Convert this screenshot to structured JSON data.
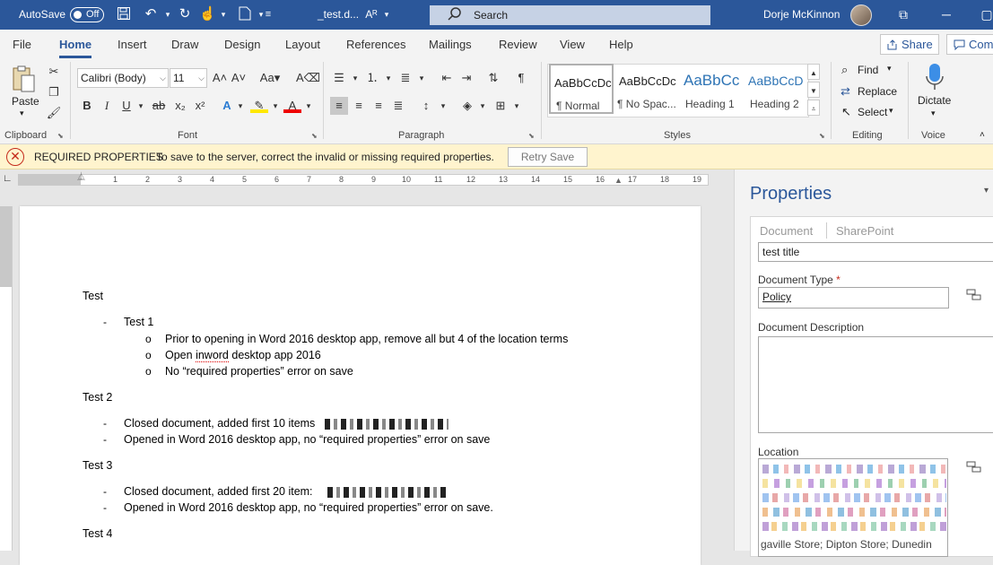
{
  "titlebar": {
    "autosave_label": "AutoSave",
    "autosave_state": "Off",
    "doc_name": "_test.d...",
    "search_placeholder": "Search",
    "user_name": "Dorje McKinnon"
  },
  "tabs": [
    "File",
    "Home",
    "Insert",
    "Draw",
    "Design",
    "Layout",
    "References",
    "Mailings",
    "Review",
    "View",
    "Help"
  ],
  "active_tab": "Home",
  "share_label": "Share",
  "comments_label": "Com",
  "ribbon": {
    "clipboard": {
      "paste_label": "Paste",
      "group_label": "Clipboard"
    },
    "font": {
      "font_name": "Calibri (Body)",
      "font_size": "11",
      "group_label": "Font",
      "case_label": "Aa"
    },
    "paragraph": {
      "group_label": "Paragraph"
    },
    "styles": {
      "group_label": "Styles",
      "items": [
        {
          "preview": "AaBbCcDc",
          "name": "¶ Normal"
        },
        {
          "preview": "AaBbCcDc",
          "name": "¶ No Spac..."
        },
        {
          "preview": "AaBbCc",
          "name": "Heading 1"
        },
        {
          "preview": "AaBbCcD",
          "name": "Heading 2"
        }
      ]
    },
    "editing": {
      "find": "Find",
      "replace": "Replace",
      "select": "Select",
      "group_label": "Editing"
    },
    "voice": {
      "dictate": "Dictate",
      "group_label": "Voice"
    }
  },
  "infobar": {
    "heading": "REQUIRED PROPERTIES",
    "message": "To save to the server, correct the invalid or missing required properties.",
    "retry_label": "Retry Save"
  },
  "ruler_numbers": [
    "1",
    "2",
    "3",
    "4",
    "5",
    "6",
    "7",
    "8",
    "9",
    "10",
    "11",
    "12",
    "13",
    "14",
    "15",
    "16",
    "17",
    "18",
    "19"
  ],
  "document": {
    "t1": "Test",
    "t1_b1": "Test 1",
    "t1_s1": "Prior to opening in Word 2016 desktop app, remove all but 4 of the location terms",
    "t1_s2_a": "Open ",
    "t1_s2_b": "inword",
    "t1_s2_c": " desktop app 2016",
    "t1_s3": "No “required properties” error on save",
    "t2": "Test 2",
    "t2_b1": "Closed document, added first 10 items",
    "t2_b2": "Opened in Word 2016 desktop app, no “required properties” error on save",
    "t3": "Test 3",
    "t3_b1": "Closed document, added first 20 item:",
    "t3_b2": "Opened in Word 2016 desktop app, no “required properties” error on save.",
    "t4": "Test 4"
  },
  "properties": {
    "title": "Properties",
    "tab_document": "Document",
    "tab_sharepoint": "SharePoint",
    "title_value": "test title",
    "doctype_label": "Document Type",
    "required_mark": "*",
    "doctype_value": "Policy",
    "description_label": "Document Description",
    "location_label": "Location",
    "location_tail": "gaville Store; Dipton Store; Dunedin"
  }
}
